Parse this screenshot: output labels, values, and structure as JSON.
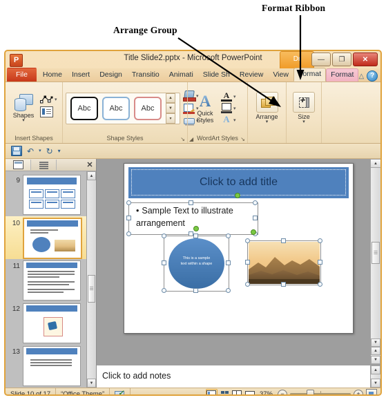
{
  "annotations": [
    {
      "id": "format-ribbon",
      "text": "Format Ribbon"
    },
    {
      "id": "arrange-group",
      "text": "Arrange Group"
    }
  ],
  "window": {
    "title": "Title Slide2.pptx  -  Microsoft PowerPoint",
    "logo": "powerpoint-logo",
    "contextual_tab_group": "Dr",
    "controls": {
      "minimize": "—",
      "restore": "❐",
      "close": "✕"
    }
  },
  "ribbon": {
    "tabs": [
      {
        "label": "File",
        "kind": "file"
      },
      {
        "label": "Home",
        "kind": "normal"
      },
      {
        "label": "Insert",
        "kind": "normal"
      },
      {
        "label": "Design",
        "kind": "normal"
      },
      {
        "label": "Transitio",
        "kind": "normal"
      },
      {
        "label": "Animati",
        "kind": "normal"
      },
      {
        "label": "Slide Sh",
        "kind": "normal"
      },
      {
        "label": "Review",
        "kind": "normal"
      },
      {
        "label": "View",
        "kind": "normal"
      },
      {
        "label": "Format",
        "kind": "active"
      },
      {
        "label": "Format",
        "kind": "contextual"
      }
    ],
    "collapse_icon": "chevron-up-icon",
    "help_icon": "?",
    "groups": [
      {
        "name": "Insert Shapes",
        "title": "Insert Shapes",
        "commands": [
          {
            "label": "Shapes",
            "icon": "shapes-icon",
            "caret": "▾"
          },
          {
            "label": "",
            "icon": "edit-points-icon",
            "caret": "▾"
          },
          {
            "label": "",
            "icon": "text-box-icon",
            "caret": ""
          }
        ]
      },
      {
        "name": "Shape Styles",
        "title": "Shape Styles",
        "gallery": [
          {
            "label": "Abc",
            "style": "black-outline"
          },
          {
            "label": "Abc",
            "style": "blue-outline"
          },
          {
            "label": "Abc",
            "style": "red-outline"
          }
        ],
        "commands": [
          {
            "label": "",
            "icon": "shape-fill-icon",
            "caret": "▾"
          },
          {
            "label": "",
            "icon": "shape-outline-icon",
            "caret": "▾"
          },
          {
            "label": "",
            "icon": "shape-effects-icon",
            "caret": "▾"
          }
        ],
        "dialog_launcher": "↘"
      },
      {
        "name": "WordArt Styles",
        "title": "WordArt Styles",
        "commands": [
          {
            "label": "Quick Styles",
            "icon": "wordart-quick-styles-icon",
            "caret": "▾"
          },
          {
            "label": "",
            "icon": "text-fill-icon",
            "caret": "▾"
          },
          {
            "label": "",
            "icon": "text-outline-icon",
            "caret": "▾"
          },
          {
            "label": "",
            "icon": "text-effects-icon",
            "caret": "▾"
          }
        ],
        "dialog_launcher": "↘"
      },
      {
        "name": "Arrange",
        "title": "",
        "commands": [
          {
            "label": "Arrange",
            "icon": "arrange-icon",
            "caret": "▾"
          }
        ]
      },
      {
        "name": "Size",
        "title": "",
        "commands": [
          {
            "label": "Size",
            "icon": "size-icon",
            "caret": "▾"
          }
        ]
      }
    ]
  },
  "quick_access": {
    "items": [
      {
        "name": "save-button",
        "icon": "save-icon"
      },
      {
        "name": "undo-button",
        "icon": "undo-icon",
        "glyph": "↶",
        "caret": "▾"
      },
      {
        "name": "redo-button",
        "icon": "redo-icon",
        "glyph": "↻"
      },
      {
        "name": "customize-qat-button",
        "icon": "chevron-down-icon",
        "glyph": "▾"
      }
    ]
  },
  "slides_pane": {
    "tabs": [
      {
        "label": "",
        "name": "slides-tab",
        "icon": "slides-tab-icon",
        "selected": true
      },
      {
        "label": "",
        "name": "outline-tab",
        "icon": "outline-tab-icon",
        "selected": false
      }
    ],
    "close_label": "✕",
    "thumbnails": [
      {
        "number": "9",
        "layout": "six-boxes",
        "selected": false
      },
      {
        "number": "10",
        "layout": "arrangement",
        "selected": true
      },
      {
        "number": "11",
        "layout": "text-lines",
        "selected": false
      },
      {
        "number": "12",
        "layout": "framed-picture",
        "selected": false
      },
      {
        "number": "13",
        "layout": "table",
        "selected": false
      }
    ]
  },
  "slide": {
    "title_placeholder": "Click to add title",
    "body_bullet": "•",
    "body_text": "Sample Text to illustrate arrangement",
    "shape_text_line1": "This is a sample",
    "shape_text_line2": "text within a shape",
    "picture_alt": "mountain-sunset-picture",
    "colors": {
      "title_band": "#4f81bd",
      "title_text": "#17365d",
      "shape_fill": "#3a6ea5",
      "selection_handle": "#f5f8fb",
      "rotation_handle": "#7ac943"
    }
  },
  "notes": {
    "placeholder": "Click to add notes"
  },
  "status_bar": {
    "slide_counter": "Slide 10 of 17",
    "theme": "“Office Theme”",
    "spellcheck_icon": "spellcheck-icon",
    "views": [
      {
        "name": "view-normal",
        "icon": "normal-view-icon",
        "selected": true
      },
      {
        "name": "view-slide-sorter",
        "icon": "slide-sorter-icon",
        "selected": false
      },
      {
        "name": "view-reading",
        "icon": "reading-view-icon",
        "selected": false
      },
      {
        "name": "view-slideshow",
        "icon": "slideshow-view-icon",
        "selected": false
      }
    ],
    "zoom_level": "37%",
    "zoom_out": "−",
    "zoom_in": "+",
    "fit_button": "fit-slide-icon"
  }
}
